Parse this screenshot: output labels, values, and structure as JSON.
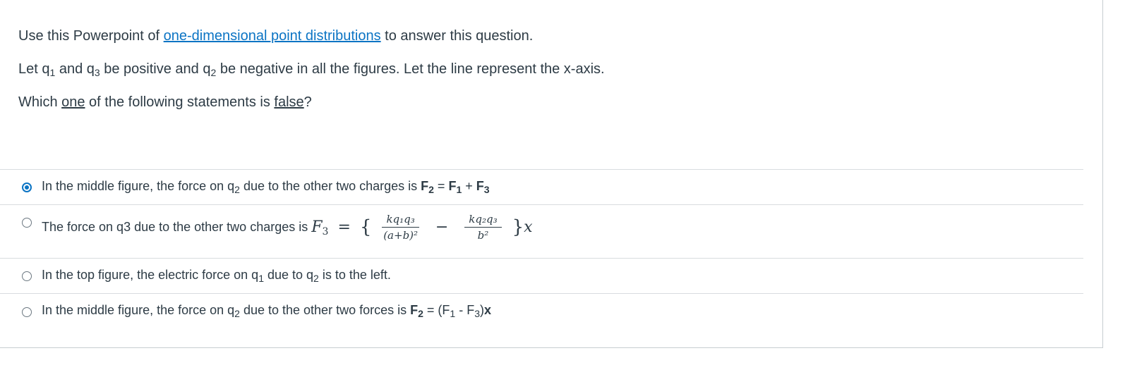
{
  "question": {
    "line1_pre": "Use this Powerpoint of ",
    "line1_link": "one-dimensional point distributions",
    "line1_post": " to answer this question.",
    "line2_a": "Let q",
    "line2_b": " and q",
    "line2_c": " be positive and q",
    "line2_d": " be negative in all the figures. Let the line represent the x-axis.",
    "sub1": "1",
    "sub2": "2",
    "sub3": "3",
    "line3_pre": "Which ",
    "line3_one": "one",
    "line3_mid": " of the following statements is ",
    "line3_false": "false",
    "line3_post": "?"
  },
  "answers": [
    {
      "selected": true,
      "a1": "In the middle figure, the force on q",
      "a1_sub": "2",
      "a1_mid": " due to the other two charges is ",
      "F": "F",
      "sub2": "2",
      "eq": " = ",
      "sub1": "1",
      "plus": " + ",
      "sub3": "3"
    },
    {
      "selected": false,
      "text": "The force on q3 due to the other two charges is",
      "F3": "F",
      "F3_sub": "3",
      "eq": "=",
      "lbrace": "{",
      "num1": "kq₁q₃",
      "den1": "(a+b)²",
      "minus": "−",
      "num2": "kq₂q₃",
      "den2": "b²",
      "rbrace": "}",
      "x": "x"
    },
    {
      "selected": false,
      "a1": "In the top figure, the electric force on q",
      "sub1": "1",
      "a2": " due to q",
      "sub2": "2",
      "a3": " is to the left."
    },
    {
      "selected": false,
      "a1": "In the middle figure, the force on q",
      "sub2": "2",
      "a2": " due to the other two forces is ",
      "F": "F",
      "eq": " = (F",
      "sub1": "1",
      "minus": " - F",
      "sub3": "3",
      "close": ")",
      "x": "x"
    }
  ],
  "colors": {
    "accent": "#0b74c4",
    "text": "#2d3b45",
    "divider": "#d8dcdf"
  }
}
